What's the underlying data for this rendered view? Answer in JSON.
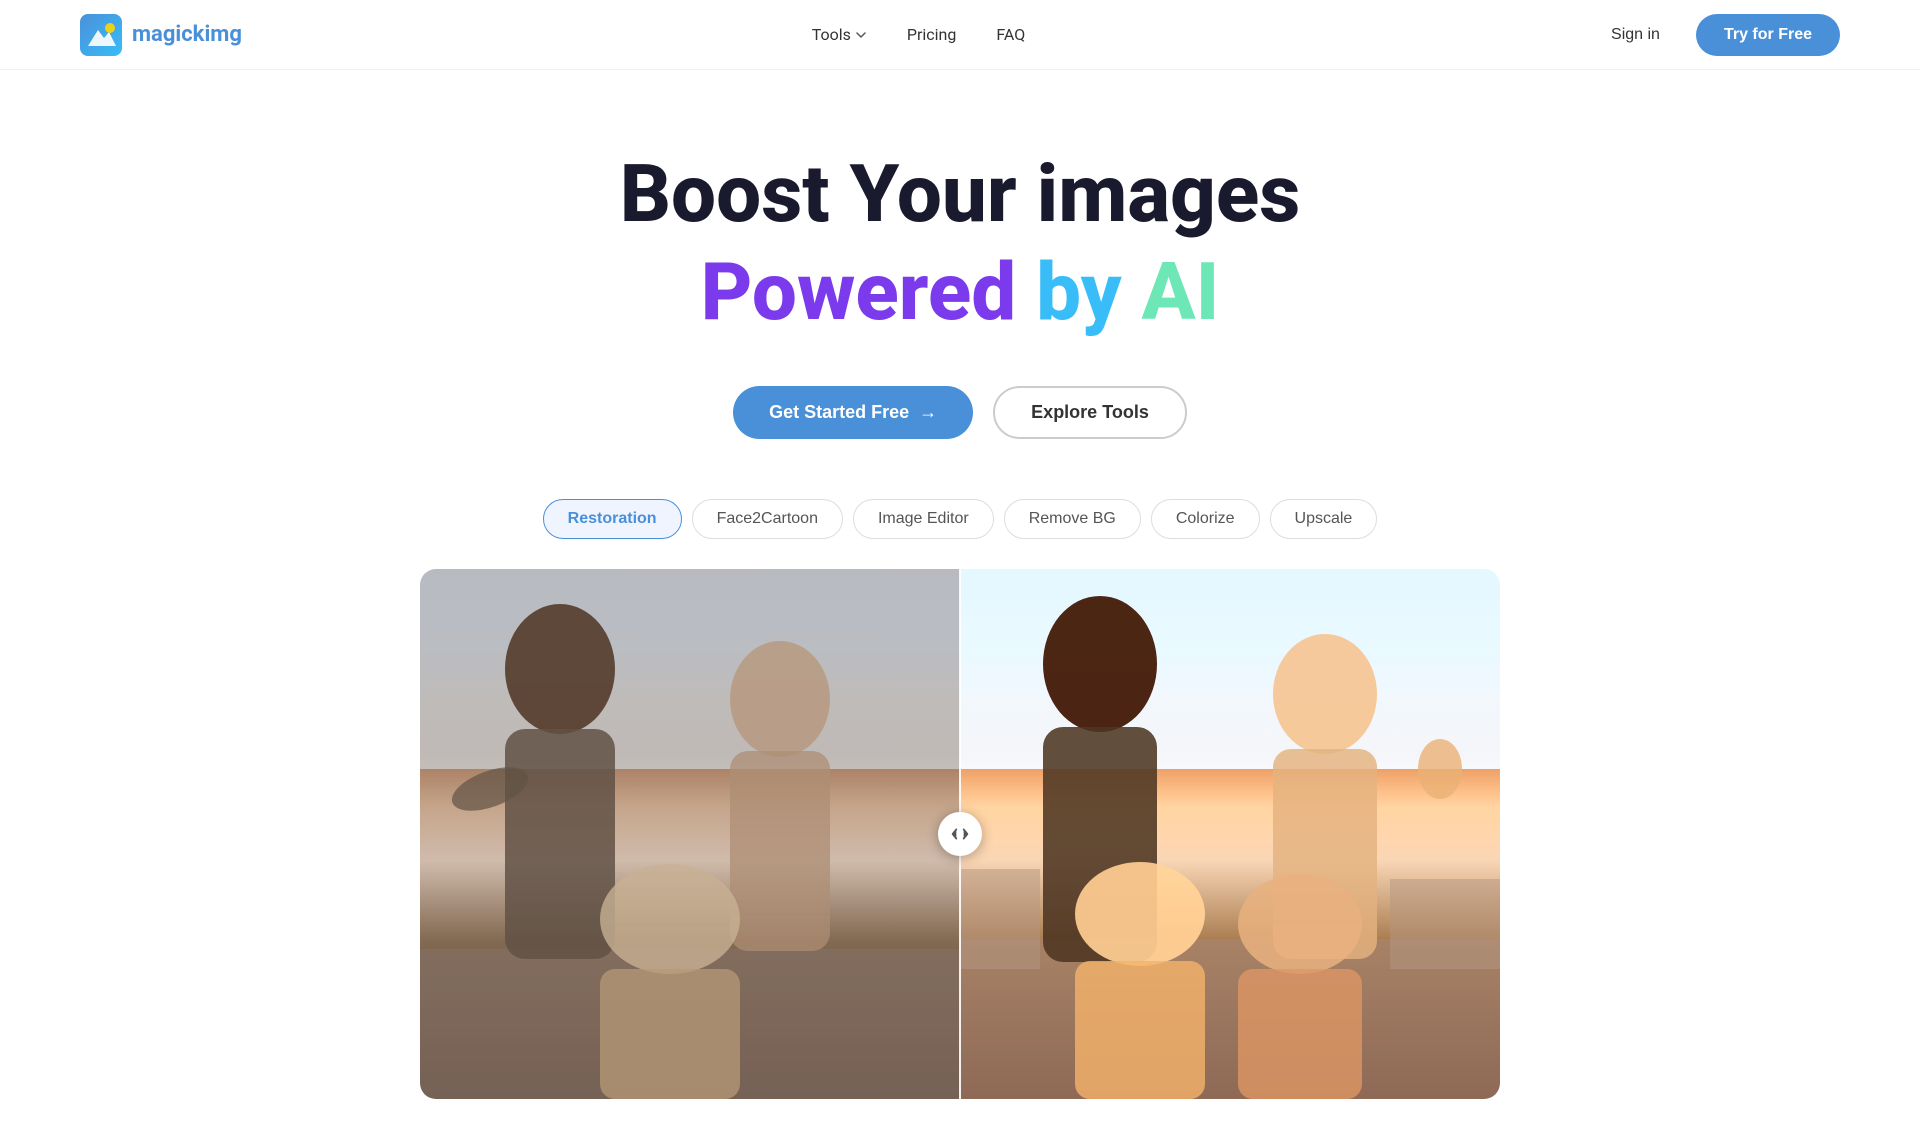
{
  "brand": {
    "name": "magickimg",
    "logo_alt": "MagickImg Logo"
  },
  "navbar": {
    "tools_label": "Tools",
    "pricing_label": "Pricing",
    "faq_label": "FAQ",
    "sign_in_label": "Sign in",
    "try_free_label": "Try for Free"
  },
  "hero": {
    "title_line1": "Boost Your images",
    "title_line2_powered": "Powered",
    "title_line2_by": "by",
    "title_line2_ai": "AI",
    "get_started_label": "Get Started Free",
    "get_started_arrow": "→",
    "explore_tools_label": "Explore Tools"
  },
  "tool_tabs": [
    {
      "id": "restoration",
      "label": "Restoration",
      "active": true
    },
    {
      "id": "face2cartoon",
      "label": "Face2Cartoon",
      "active": false
    },
    {
      "id": "image-editor",
      "label": "Image Editor",
      "active": false
    },
    {
      "id": "remove-bg",
      "label": "Remove BG",
      "active": false
    },
    {
      "id": "colorize",
      "label": "Colorize",
      "active": false
    },
    {
      "id": "upscale",
      "label": "Upscale",
      "active": false
    }
  ],
  "comparison": {
    "divider_icon": "◀▶"
  },
  "colors": {
    "brand_blue": "#4a90d9",
    "powered_purple": "#7c3aed",
    "by_cyan": "#38bdf8",
    "ai_green": "#6ee7b7",
    "active_tab_bg": "#f0f4ff",
    "active_tab_border": "#4a90d9"
  }
}
